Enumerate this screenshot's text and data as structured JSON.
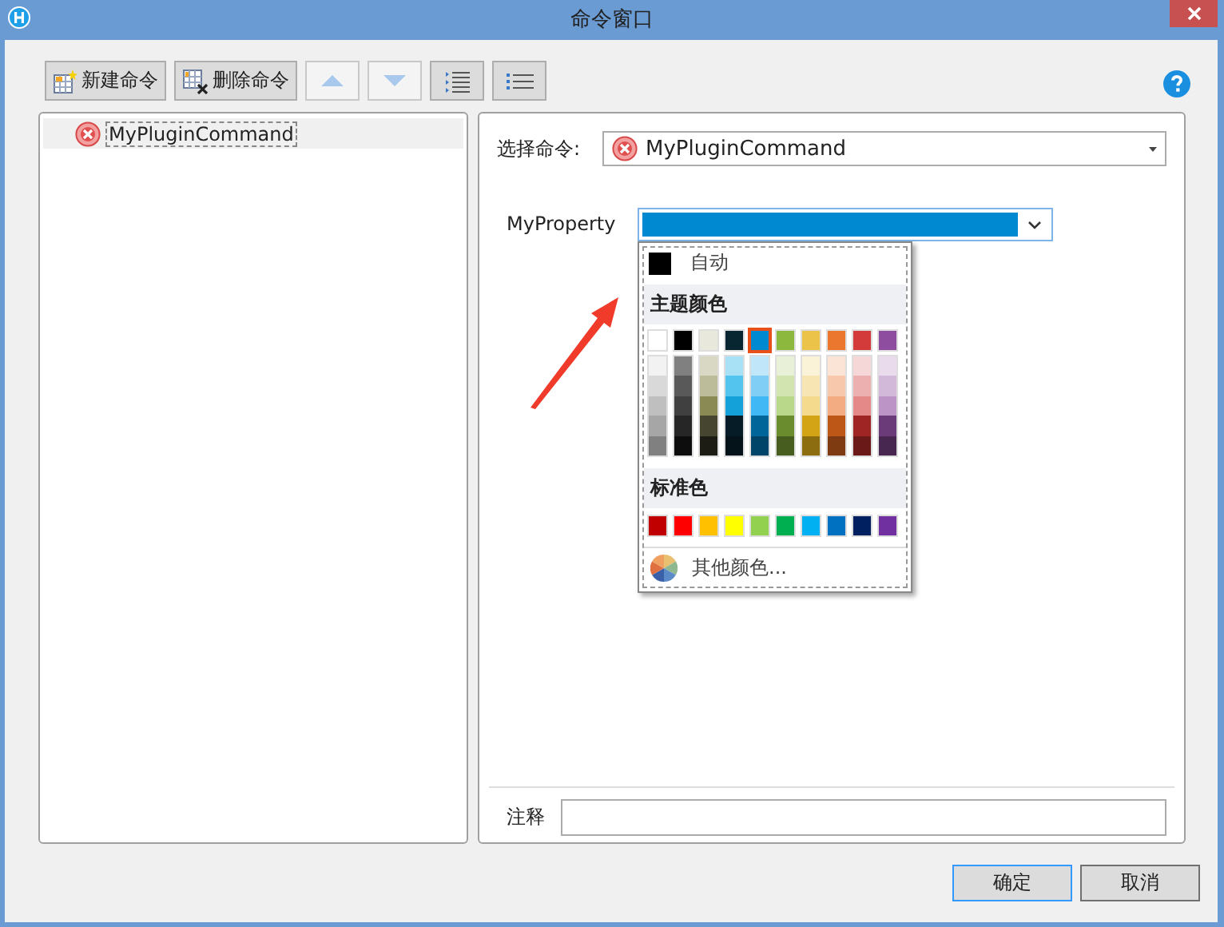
{
  "window": {
    "title": "命令窗口"
  },
  "toolbar": [
    {
      "kind": "new",
      "label": "新建命令",
      "disabled": false
    },
    {
      "kind": "delete",
      "label": "删除命令",
      "disabled": false
    },
    {
      "kind": "up",
      "disabled": true
    },
    {
      "kind": "down",
      "disabled": true
    },
    {
      "kind": "indent",
      "disabled": false
    },
    {
      "kind": "outdent",
      "disabled": false
    }
  ],
  "command_list": [
    {
      "label": "MyPluginCommand",
      "selected": true
    }
  ],
  "command_select": {
    "label": "选择命令:",
    "value": "MyPluginCommand"
  },
  "property": {
    "label": "MyProperty",
    "color": "#0088d0"
  },
  "color_picker": {
    "auto_label": "自动",
    "theme_header": "主题颜色",
    "standard_header": "标准色",
    "more_label": "其他颜色...",
    "theme_columns": [
      {
        "color": "#ffffff",
        "selected": false,
        "shades": [
          {
            "color": "#f2f2f2"
          },
          {
            "color": "#d9d9d9"
          },
          {
            "color": "#bfbfbf"
          },
          {
            "color": "#a6a6a6"
          },
          {
            "color": "#808080"
          }
        ]
      },
      {
        "color": "#000000",
        "selected": false,
        "shades": [
          {
            "color": "#808080"
          },
          {
            "color": "#595959"
          },
          {
            "color": "#404040"
          },
          {
            "color": "#262626"
          },
          {
            "color": "#0d0d0d"
          }
        ]
      },
      {
        "color": "#e8e8dc",
        "selected": false,
        "shades": [
          {
            "color": "#d8d8c4"
          },
          {
            "color": "#bcbc9a"
          },
          {
            "color": "#8a8a55"
          },
          {
            "color": "#454530"
          },
          {
            "color": "#1c1c14"
          }
        ]
      },
      {
        "color": "#082632",
        "selected": false,
        "shades": [
          {
            "color": "#a8e0f5"
          },
          {
            "color": "#52c4ed"
          },
          {
            "color": "#14a0d8"
          },
          {
            "color": "#061c26"
          },
          {
            "color": "#041319"
          }
        ]
      },
      {
        "color": "#0088d0",
        "selected": true,
        "shades": [
          {
            "color": "#c0e6fa"
          },
          {
            "color": "#80cdf5"
          },
          {
            "color": "#40b8f5"
          },
          {
            "color": "#006699"
          },
          {
            "color": "#00446a"
          }
        ]
      },
      {
        "color": "#8db83e",
        "selected": false,
        "shades": [
          {
            "color": "#e8f1d8"
          },
          {
            "color": "#d2e4b0"
          },
          {
            "color": "#bad88a"
          },
          {
            "color": "#6b8c2e"
          },
          {
            "color": "#465d1f"
          }
        ]
      },
      {
        "color": "#ebc348",
        "selected": false,
        "shades": [
          {
            "color": "#fbf3d8"
          },
          {
            "color": "#f7e6b3"
          },
          {
            "color": "#f3da8d"
          },
          {
            "color": "#d4a417"
          },
          {
            "color": "#8c6d0f"
          }
        ]
      },
      {
        "color": "#eb762e",
        "selected": false,
        "shades": [
          {
            "color": "#fbe3d5"
          },
          {
            "color": "#f7c8ab"
          },
          {
            "color": "#f3ac81"
          },
          {
            "color": "#bd5718"
          },
          {
            "color": "#7e3a10"
          }
        ]
      },
      {
        "color": "#d33a3a",
        "selected": false,
        "shades": [
          {
            "color": "#f6d7d7"
          },
          {
            "color": "#edb0b0"
          },
          {
            "color": "#e48888"
          },
          {
            "color": "#9f2424"
          },
          {
            "color": "#6a1818"
          }
        ]
      },
      {
        "color": "#8f4da0",
        "selected": false,
        "shades": [
          {
            "color": "#e9dbec"
          },
          {
            "color": "#d2b8d9"
          },
          {
            "color": "#bc94c6"
          },
          {
            "color": "#6b3a78"
          },
          {
            "color": "#472750"
          }
        ]
      }
    ],
    "standard_colors": [
      {
        "color": "#c00000",
        "selected": false
      },
      {
        "color": "#ff0000",
        "selected": false
      },
      {
        "color": "#ffc000",
        "selected": false
      },
      {
        "color": "#ffff00",
        "selected": false
      },
      {
        "color": "#92d050",
        "selected": false
      },
      {
        "color": "#00b050",
        "selected": false
      },
      {
        "color": "#00b0f0",
        "selected": false
      },
      {
        "color": "#0070c0",
        "selected": false
      },
      {
        "color": "#002060",
        "selected": false
      },
      {
        "color": "#7030a0",
        "selected": false
      }
    ]
  },
  "comment": {
    "label": "注释"
  },
  "buttons": [
    {
      "label": "确定",
      "default": true
    },
    {
      "label": "取消",
      "default": false
    }
  ]
}
